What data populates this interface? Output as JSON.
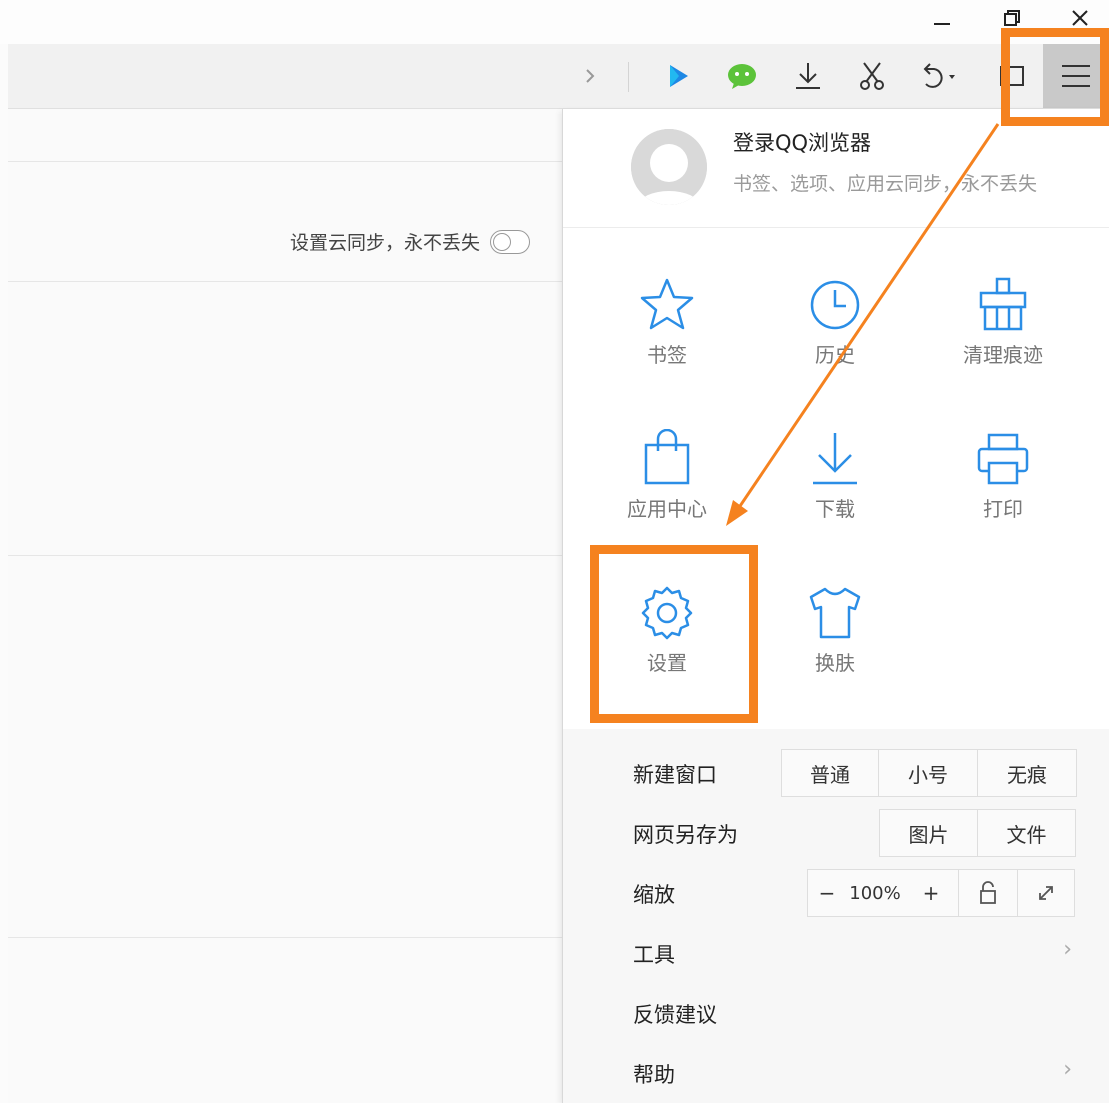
{
  "window": {
    "minimize_icon": "minimize-icon",
    "restore_icon": "restore-icon",
    "close_icon": "close-icon"
  },
  "toolbar": {
    "icons": [
      "chevron-right-icon",
      "video-play-icon",
      "wechat-icon",
      "download-icon",
      "scissors-icon",
      "undo-icon",
      "sidebar-icon",
      "hamburger-menu-icon"
    ]
  },
  "page": {
    "sync_text": "设置云同步，永不丢失"
  },
  "menu": {
    "user": {
      "title": "登录QQ浏览器",
      "subtitle": "书签、选项、应用云同步，永不丢失"
    },
    "grid": [
      {
        "label": "书签",
        "icon": "star-icon"
      },
      {
        "label": "历史",
        "icon": "clock-icon"
      },
      {
        "label": "清理痕迹",
        "icon": "broom-icon"
      },
      {
        "label": "应用中心",
        "icon": "shopping-bag-icon"
      },
      {
        "label": "下载",
        "icon": "download-icon"
      },
      {
        "label": "打印",
        "icon": "printer-icon"
      },
      {
        "label": "设置",
        "icon": "gear-icon"
      },
      {
        "label": "换肤",
        "icon": "tshirt-icon"
      }
    ],
    "new_window": {
      "label": "新建窗口",
      "options": [
        "普通",
        "小号",
        "无痕"
      ]
    },
    "save_page": {
      "label": "网页另存为",
      "options": [
        "图片",
        "文件"
      ]
    },
    "zoom": {
      "label": "缩放",
      "minus": "−",
      "value": "100%",
      "plus": "+"
    },
    "tools_label": "工具",
    "feedback_label": "反馈建议",
    "help_label": "帮助",
    "chevron": "›"
  },
  "colors": {
    "accent": "#2b8ee6",
    "highlight": "#f5821f",
    "wechat_green": "#5cc33a"
  }
}
